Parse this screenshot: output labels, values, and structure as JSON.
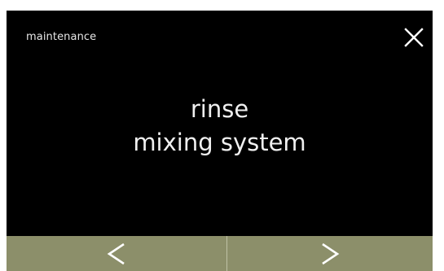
{
  "header": {
    "title": "maintenance",
    "close_icon": "close-icon"
  },
  "message": {
    "line1": "rinse",
    "line2": "mixing system"
  },
  "navigation": {
    "prev_icon": "chevron-left-icon",
    "next_icon": "chevron-right-icon",
    "button_color": "#8c8f6a"
  },
  "colors": {
    "background": "#000000",
    "text": "#f0f0f0"
  }
}
